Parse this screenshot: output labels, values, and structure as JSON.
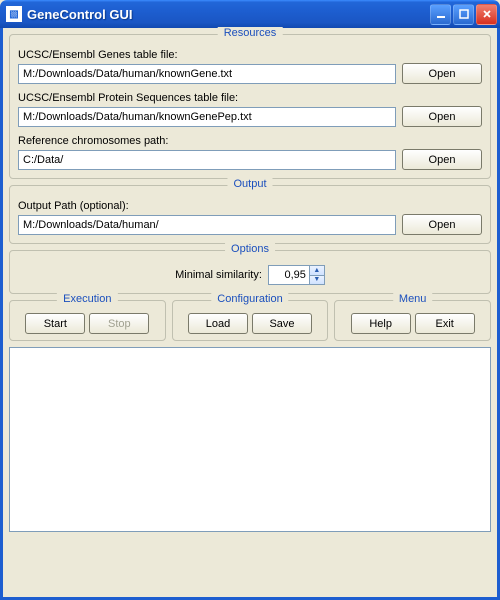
{
  "window": {
    "title": "GeneControl GUI",
    "icon_glyph": "▧"
  },
  "resources": {
    "title": "Resources",
    "genes_label": "UCSC/Ensembl Genes table file:",
    "genes_value": "M:/Downloads/Data/human/knownGene.txt",
    "protein_label": "UCSC/Ensembl Protein Sequences table file:",
    "protein_value": "M:/Downloads/Data/human/knownGenePep.txt",
    "chrom_label": "Reference chromosomes path:",
    "chrom_value": "C:/Data/",
    "open_label": "Open"
  },
  "output": {
    "title": "Output",
    "path_label": "Output Path (optional):",
    "path_value": "M:/Downloads/Data/human/",
    "open_label": "Open"
  },
  "options": {
    "title": "Options",
    "min_sim_label": "Minimal similarity:",
    "min_sim_value": "0,95"
  },
  "execution": {
    "title": "Execution",
    "start_label": "Start",
    "stop_label": "Stop"
  },
  "configuration": {
    "title": "Configuration",
    "load_label": "Load",
    "save_label": "Save"
  },
  "menu": {
    "title": "Menu",
    "help_label": "Help",
    "exit_label": "Exit"
  }
}
